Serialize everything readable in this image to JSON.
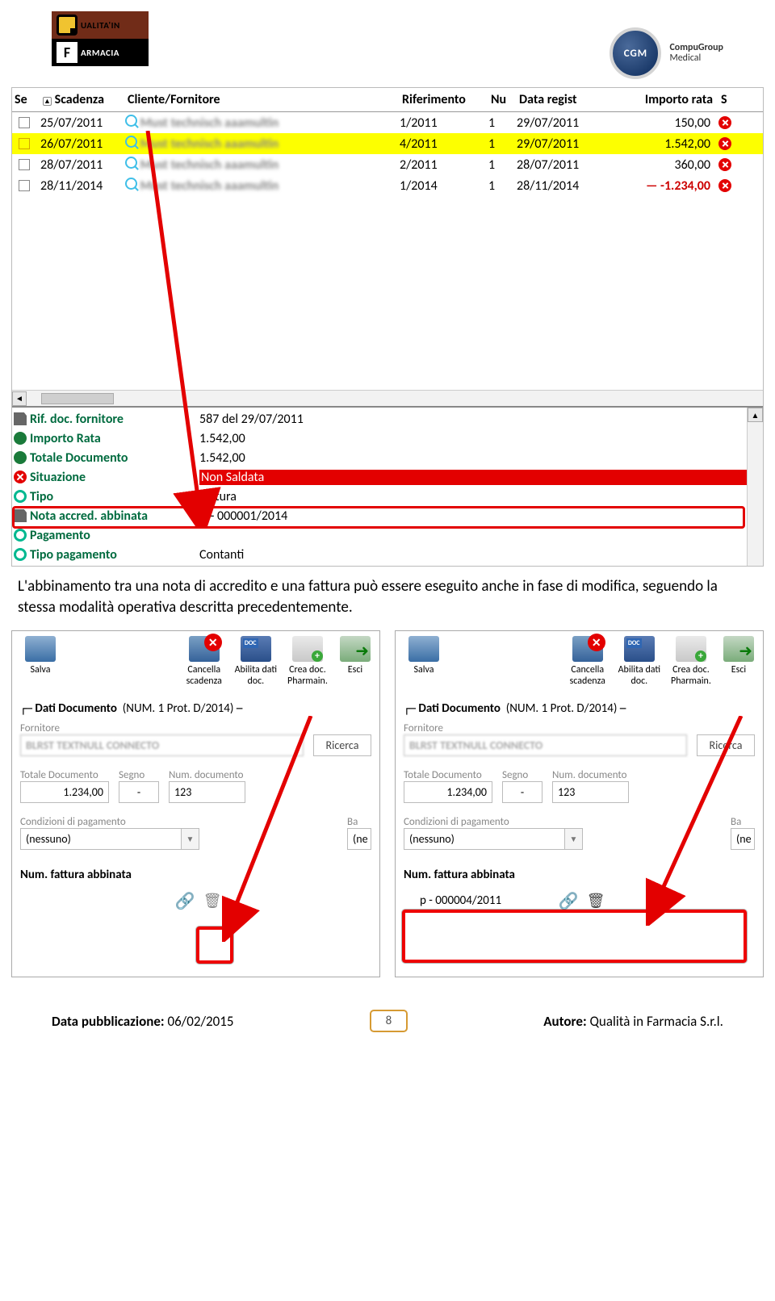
{
  "header": {
    "qf_top": "UALITA'IN",
    "qf_bot": "ARMACIA",
    "cgm_abbr": "CGM",
    "cgm_name": "CompuGroup",
    "cgm_sub": "Medical"
  },
  "grid": {
    "cols": [
      "Se",
      "Scadenza",
      "Cliente/Fornitore",
      "Riferimento",
      "Nu",
      "Data regist",
      "Importo rata",
      "S"
    ],
    "rows": [
      {
        "date": "25/07/2011",
        "ref": "1/2011",
        "n": "1",
        "reg": "29/07/2011",
        "amt": "150,00",
        "hl": false
      },
      {
        "date": "26/07/2011",
        "ref": "4/2011",
        "n": "1",
        "reg": "29/07/2011",
        "amt": "1.542,00",
        "hl": true
      },
      {
        "date": "28/07/2011",
        "ref": "2/2011",
        "n": "1",
        "reg": "28/07/2011",
        "amt": "360,00",
        "hl": false
      },
      {
        "date": "28/11/2014",
        "ref": "1/2014",
        "n": "1",
        "reg": "28/11/2014",
        "amt": "-1.234,00",
        "hl": false,
        "neg": true
      }
    ]
  },
  "detail": {
    "rif_lbl": "Rif. doc. fornitore",
    "rif_val": "587 del 29/07/2011",
    "imp_lbl": "Importo Rata",
    "imp_val": "1.542,00",
    "tot_lbl": "Totale Documento",
    "tot_val": "1.542,00",
    "sit_lbl": "Situazione",
    "sit_val": "Non Saldata",
    "tip_lbl": "Tipo",
    "tip_val": "Fattura",
    "nota_lbl": "Nota accred. abbinata",
    "nota_val": "D  - 000001/2014",
    "pag_lbl": "Pagamento",
    "pag_val": "",
    "tpag_lbl": "Tipo pagamento",
    "tpag_val": "Contanti"
  },
  "body_text": "L'abbinamento tra una nota di accredito e una fattura può essere eseguito anche in fase di modifica, seguendo la stessa modalità operativa descritta precedentemente.",
  "toolbar": {
    "salva": "Salva",
    "cancella": "Cancella scadenza",
    "abilita": "Abilita dati doc.",
    "crea": "Crea doc. Pharmain.",
    "esci": "Esci"
  },
  "form": {
    "fs": "Dati Documento",
    "fs_code": "(NUM. 1 Prot. D/2014)",
    "fornitore": "Fornitore",
    "ricerca": "Ricerca",
    "tot": "Totale Documento",
    "tot_val": "1.234,00",
    "segno": "Segno",
    "segno_val": "-",
    "numdoc": "Num. documento",
    "numdoc_val": "123",
    "cond": "Condizioni di pagamento",
    "cond_val": "(nessuno)",
    "ba": "Ba",
    "ne": "(ne",
    "numabb": "Num. fattura abbinata",
    "abb_val2": "p  - 000004/2011"
  },
  "footer": {
    "pub_lbl": "Data pubblicazione:",
    "pub_val": " 06/02/2015",
    "page": "8",
    "aut_lbl": "Autore:",
    "aut_val": " Qualità in Farmacia S.r.l."
  }
}
